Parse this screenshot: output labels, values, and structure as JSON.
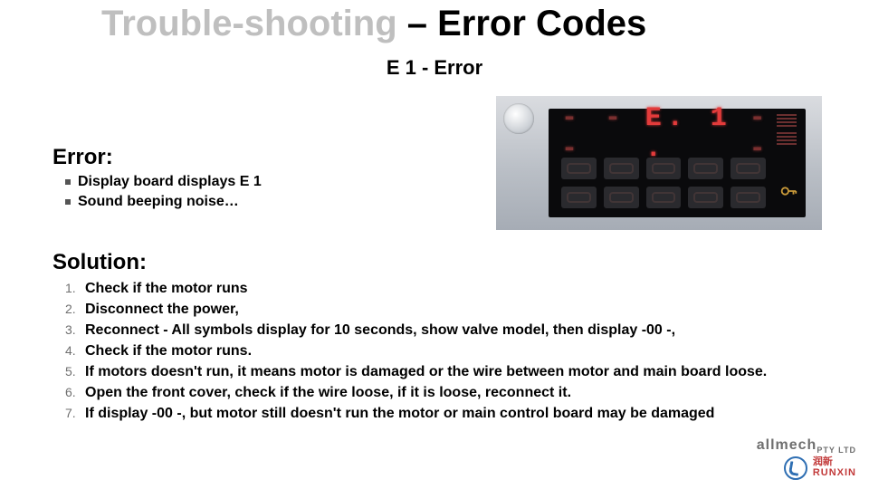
{
  "title": {
    "part1": "Trouble-shooting",
    "sep": " – ",
    "part2": "Error Codes"
  },
  "subtitle": "E 1 - Error",
  "error": {
    "heading": "Error:",
    "items": [
      "Display board displays E 1",
      "Sound beeping noise…"
    ]
  },
  "solution": {
    "heading": "Solution:",
    "items": [
      "Check if the motor runs",
      "Disconnect the power,",
      "Reconnect -  All symbols display for 10 seconds, show valve model, then display -00 -,",
      "Check if the motor runs.",
      "If motors doesn't run, it means motor is damaged or the wire between motor and main board loose.",
      "Open the front cover, check if the wire loose, if it is loose, reconnect it.",
      "If display -00 -, but motor still doesn't run the motor or main control board may be damaged"
    ]
  },
  "panel": {
    "seg_left": "- - -",
    "seg_code": "E. 1 .",
    "seg_trail": "- -"
  },
  "logos": {
    "allmech": "allmech",
    "allmech_sub": "PTY LTD",
    "runxin_cn": "润新",
    "runxin_en": "RUNXIN"
  }
}
